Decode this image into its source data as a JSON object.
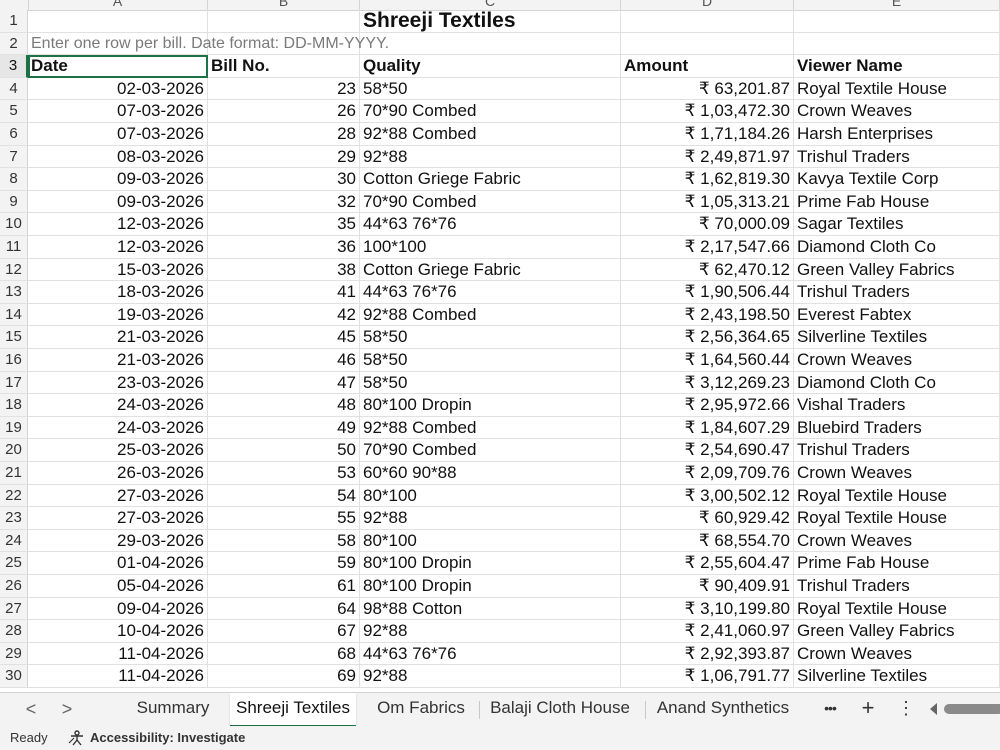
{
  "sheet": {
    "columns": [
      "A",
      "B",
      "C",
      "D",
      "E"
    ],
    "title": "Shreeji Textiles",
    "note": "Enter one row per bill. Date format: DD-MM-YYYY.",
    "headers": [
      "Date",
      "Bill No.",
      "Quality",
      "Amount",
      "Viewer Name"
    ],
    "row_numbers": [
      "1",
      "2",
      "3",
      "4",
      "5",
      "6",
      "7",
      "8",
      "9",
      "10",
      "11",
      "12",
      "13",
      "14",
      "15",
      "16",
      "17",
      "18",
      "19",
      "20",
      "21",
      "22",
      "23",
      "24",
      "25",
      "26",
      "27",
      "28",
      "29",
      "30"
    ],
    "rows": [
      [
        "02-03-2026",
        "23",
        "58*50",
        "₹ 63,201.87",
        "Royal Textile House"
      ],
      [
        "07-03-2026",
        "26",
        "70*90 Combed",
        "₹ 1,03,472.30",
        "Crown Weaves"
      ],
      [
        "07-03-2026",
        "28",
        "92*88 Combed",
        "₹ 1,71,184.26",
        "Harsh Enterprises"
      ],
      [
        "08-03-2026",
        "29",
        "92*88",
        "₹ 2,49,871.97",
        "Trishul Traders"
      ],
      [
        "09-03-2026",
        "30",
        "Cotton Griege Fabric",
        "₹ 1,62,819.30",
        "Kavya Textile Corp"
      ],
      [
        "09-03-2026",
        "32",
        "70*90 Combed",
        "₹ 1,05,313.21",
        "Prime Fab House"
      ],
      [
        "12-03-2026",
        "35",
        "44*63 76*76",
        "₹ 70,000.09",
        "Sagar Textiles"
      ],
      [
        "12-03-2026",
        "36",
        "100*100",
        "₹ 2,17,547.66",
        "Diamond Cloth Co"
      ],
      [
        "15-03-2026",
        "38",
        "Cotton Griege Fabric",
        "₹ 62,470.12",
        "Green Valley Fabrics"
      ],
      [
        "18-03-2026",
        "41",
        "44*63 76*76",
        "₹ 1,90,506.44",
        "Trishul Traders"
      ],
      [
        "19-03-2026",
        "42",
        "92*88 Combed",
        "₹ 2,43,198.50",
        "Everest Fabtex"
      ],
      [
        "21-03-2026",
        "45",
        "58*50",
        "₹ 2,56,364.65",
        "Silverline Textiles"
      ],
      [
        "21-03-2026",
        "46",
        "58*50",
        "₹ 1,64,560.44",
        "Crown Weaves"
      ],
      [
        "23-03-2026",
        "47",
        "58*50",
        "₹ 3,12,269.23",
        "Diamond Cloth Co"
      ],
      [
        "24-03-2026",
        "48",
        "80*100 Dropin",
        "₹ 2,95,972.66",
        "Vishal Traders"
      ],
      [
        "24-03-2026",
        "49",
        "92*88 Combed",
        "₹ 1,84,607.29",
        "Bluebird Traders"
      ],
      [
        "25-03-2026",
        "50",
        "70*90 Combed",
        "₹ 2,54,690.47",
        "Trishul Traders"
      ],
      [
        "26-03-2026",
        "53",
        "60*60 90*88",
        "₹ 2,09,709.76",
        "Crown Weaves"
      ],
      [
        "27-03-2026",
        "54",
        "80*100",
        "₹ 3,00,502.12",
        "Royal Textile House"
      ],
      [
        "27-03-2026",
        "55",
        "92*88",
        "₹ 60,929.42",
        "Royal Textile House"
      ],
      [
        "29-03-2026",
        "58",
        "80*100",
        "₹ 68,554.70",
        "Crown Weaves"
      ],
      [
        "01-04-2026",
        "59",
        "80*100 Dropin",
        "₹ 2,55,604.47",
        "Prime Fab House"
      ],
      [
        "05-04-2026",
        "61",
        "80*100 Dropin",
        "₹ 90,409.91",
        "Trishul Traders"
      ],
      [
        "09-04-2026",
        "64",
        "98*88 Cotton",
        "₹ 3,10,199.80",
        "Royal Textile House"
      ],
      [
        "10-04-2026",
        "67",
        "92*88",
        "₹ 2,41,060.97",
        "Green Valley Fabrics"
      ],
      [
        "11-04-2026",
        "68",
        "44*63 76*76",
        "₹ 2,92,393.87",
        "Crown Weaves"
      ],
      [
        "11-04-2026",
        "69",
        "92*88",
        "₹ 1,06,791.77",
        "Silverline Textiles"
      ]
    ]
  },
  "tabs": {
    "nav_prev": "<",
    "nav_next": ">",
    "items": [
      "Summary",
      "Shreeji Textiles",
      "Om Fabrics",
      "Balaji Cloth House",
      "Anand Synthetics"
    ],
    "active_index": 1,
    "more": "•••",
    "add": "+",
    "options": "⋮"
  },
  "status": {
    "ready": "Ready",
    "accessibility": "Accessibility: Investigate"
  },
  "colors": {
    "accent": "#1e7145",
    "header_bg": "#f3f3f3",
    "gridline": "#e1e1e1"
  }
}
